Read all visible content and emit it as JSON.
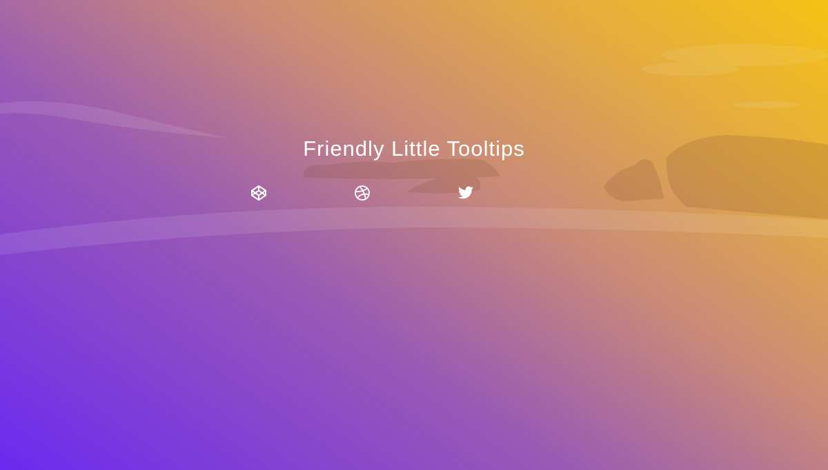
{
  "page": {
    "title": "Friendly Little Tooltips"
  },
  "social_links": [
    {
      "icon": "codepen-icon"
    },
    {
      "icon": "dribbble-icon"
    },
    {
      "icon": "twitter-icon"
    }
  ],
  "colors": {
    "gradient_start": "#6a2af0",
    "gradient_end": "#f5c213",
    "text": "#ffffff"
  }
}
